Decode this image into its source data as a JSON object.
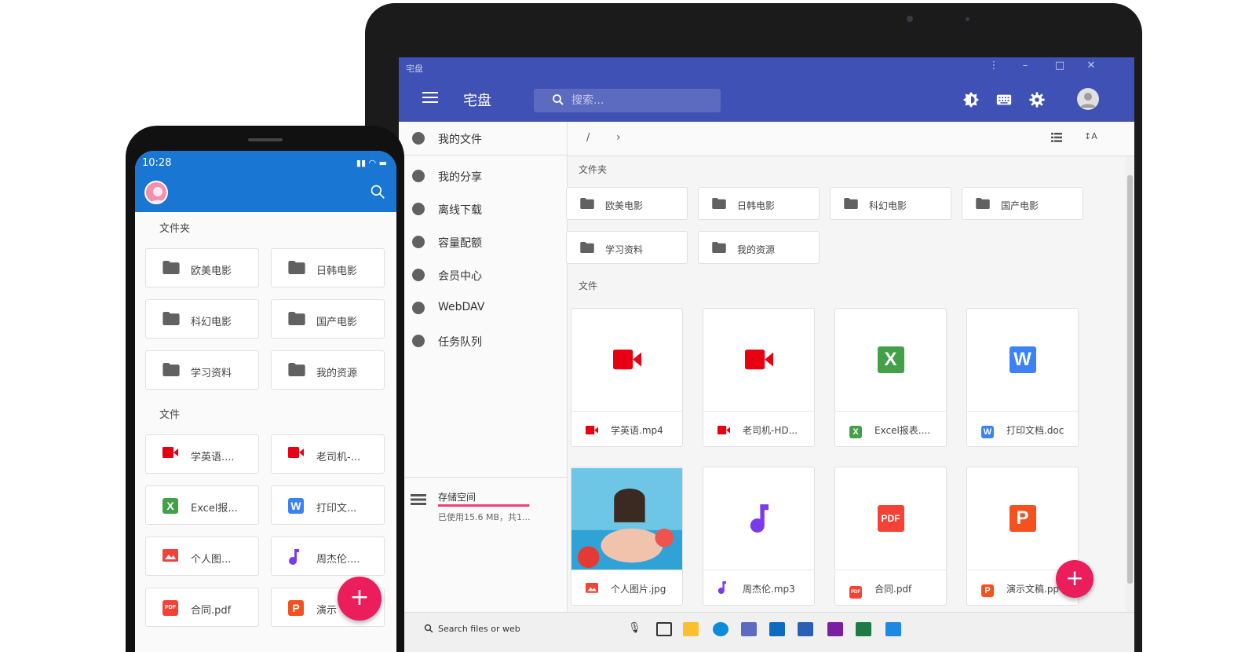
{
  "desktop": {
    "window_title": "宅盘",
    "app_title": "宅盘",
    "search_placeholder": "搜索...",
    "nav": [
      {
        "label": "我的文件",
        "icon": "person-folder-icon"
      },
      {
        "label": "我的分享",
        "icon": "share-icon"
      },
      {
        "label": "离线下载",
        "icon": "cloud-download-icon"
      },
      {
        "label": "容量配额",
        "icon": "sd-card-icon"
      },
      {
        "label": "会员中心",
        "icon": "palette-icon"
      },
      {
        "label": "WebDAV",
        "icon": "devices-icon"
      },
      {
        "label": "任务队列",
        "icon": "clipboard-icon"
      }
    ],
    "storage": {
      "title": "存储空间",
      "usage_text": "已使用15.6 MB，共1...",
      "fraction": 0.99
    },
    "breadcrumb": "/",
    "sort_label": "↕A",
    "folders_label": "文件夹",
    "files_label": "文件",
    "folders": [
      "欧美电影",
      "日韩电影",
      "科幻电影",
      "国产电影",
      "学习资料",
      "我的资源"
    ],
    "files": [
      {
        "name": "学英语.mp4",
        "type": "video"
      },
      {
        "name": "老司机-HD...",
        "type": "video"
      },
      {
        "name": "Excel报表....",
        "type": "excel"
      },
      {
        "name": "打印文档.doc",
        "type": "word"
      },
      {
        "name": "个人图片.jpg",
        "type": "image"
      },
      {
        "name": "周杰伦.mp3",
        "type": "audio"
      },
      {
        "name": "合同.pdf",
        "type": "pdf"
      },
      {
        "name": "演示文稿.pp",
        "type": "ppt"
      }
    ],
    "fab": "+",
    "taskbar_search": "Search files or web"
  },
  "phone": {
    "time": "10:28",
    "folders_label": "文件夹",
    "files_label": "文件",
    "folders": [
      "欧美电影",
      "日韩电影",
      "科幻电影",
      "国产电影",
      "学习资料",
      "我的资源"
    ],
    "files": [
      {
        "name": "学英语....",
        "type": "video"
      },
      {
        "name": "老司机-...",
        "type": "video"
      },
      {
        "name": "Excel报...",
        "type": "excel"
      },
      {
        "name": "打印文...",
        "type": "word"
      },
      {
        "name": "个人图...",
        "type": "image"
      },
      {
        "name": "周杰伦....",
        "type": "audio"
      },
      {
        "name": "合同.pdf",
        "type": "pdf"
      },
      {
        "name": "演示",
        "type": "ppt"
      }
    ],
    "fab": "+"
  },
  "badges": {
    "excel": "X",
    "word": "W",
    "ppt": "P",
    "pdf": "PDF"
  },
  "colors": {
    "primary": "#3f51b5",
    "phone_primary": "#1976d2",
    "accent": "#ec1d5b",
    "video": "#e60012",
    "excel": "#43a047",
    "word": "#3b82f6",
    "ppt": "#f4511e",
    "pdf": "#f44336",
    "audio": "#7c3aed"
  }
}
